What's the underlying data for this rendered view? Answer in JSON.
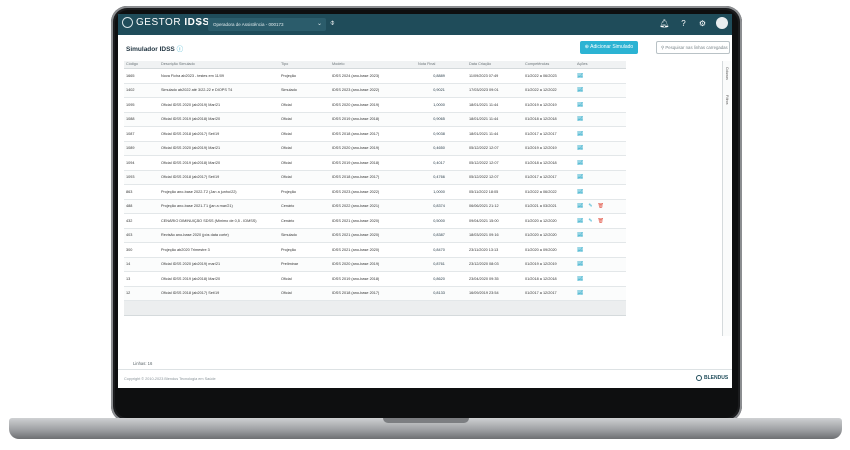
{
  "app": {
    "logo_light": "GESTOR ",
    "logo_bold": "IDSS",
    "org_select": "Operadora de Assistência - 000173"
  },
  "page": {
    "title": "Simulador IDSS",
    "add_button": "Adicionar Simulado",
    "search_placeholder": "Pesquisar nas linhas carregadas"
  },
  "table": {
    "columns": [
      "Código",
      "Descrição Simulado",
      "Tipo",
      "Modelo",
      "Nota Final",
      "Data Criação",
      "Competências",
      "Ações"
    ],
    "rows": [
      {
        "codigo": "1665",
        "descricao": "Nova Ficha ab2023 - testes em 11/09",
        "tipo": "Projeção",
        "modelo": "IDSS 2024 (ano-base 2023)",
        "nota": "0,8889",
        "data": "11/09/2023 07:49",
        "comp": "01/2022 a 06/2023",
        "acoes": [
          "chart"
        ]
      },
      {
        "codigo": "1402",
        "descricao": "Simulado ab2022 até 3/22-22 e DIOPS T4",
        "tipo": "Simulado",
        "modelo": "IDSS 2023 (ano-base 2022)",
        "nota": "0,9021",
        "data": "17/03/2023 09:01",
        "comp": "01/2022 a 12/2022",
        "acoes": [
          "chart"
        ]
      },
      {
        "codigo": "1095",
        "descricao": "Oficial IDSS 2020 (ab2019) Mar/21",
        "tipo": "Oficial",
        "modelo": "IDSS 2020 (ano-base 2019)",
        "nota": "1,0000",
        "data": "18/01/2021 11:44",
        "comp": "01/2019 a 12/2019",
        "acoes": [
          "chart"
        ]
      },
      {
        "codigo": "1088",
        "descricao": "Oficial IDSS 2019 (ab2018) Mar/20",
        "tipo": "Oficial",
        "modelo": "IDSS 2019 (ano-base 2018)",
        "nota": "0,9065",
        "data": "18/01/2021 11:44",
        "comp": "01/2018 a 12/2018",
        "acoes": [
          "chart"
        ]
      },
      {
        "codigo": "1087",
        "descricao": "Oficial IDSS 2018 (ab2017) Set/19",
        "tipo": "Oficial",
        "modelo": "IDSS 2018 (ano-base 2017)",
        "nota": "0,9038",
        "data": "18/01/2021 11:44",
        "comp": "01/2017 a 12/2017",
        "acoes": [
          "chart"
        ]
      },
      {
        "codigo": "1089",
        "descricao": "Oficial IDSS 2020 (ab2019) Mar/21",
        "tipo": "Oficial",
        "modelo": "IDSS 2020 (ano-base 2019)",
        "nota": "0,4650",
        "data": "05/12/2022 12:07",
        "comp": "01/2019 a 12/2019",
        "acoes": [
          "chart"
        ]
      },
      {
        "codigo": "1094",
        "descricao": "Oficial IDSS 2019 (ab2018) Mar/20",
        "tipo": "Oficial",
        "modelo": "IDSS 2019 (ano-base 2018)",
        "nota": "0,4017",
        "data": "05/12/2022 12:07",
        "comp": "01/2018 a 12/2018",
        "acoes": [
          "chart"
        ]
      },
      {
        "codigo": "1093",
        "descricao": "Oficial IDSS 2018 (ab2017) Set/19",
        "tipo": "Oficial",
        "modelo": "IDSS 2018 (ano-base 2017)",
        "nota": "0,4766",
        "data": "05/12/2022 12:07",
        "comp": "01/2017 a 12/2017",
        "acoes": [
          "chart"
        ]
      },
      {
        "codigo": "863",
        "descricao": "Projeção ano-base 2022-T2 (Jan a junho/22)",
        "tipo": "Projeção",
        "modelo": "IDSS 2023 (ano-base 2022)",
        "nota": "1,0000",
        "data": "05/11/2022 18:05",
        "comp": "01/2022 a 06/2022",
        "acoes": [
          "chart"
        ]
      },
      {
        "codigo": "488",
        "descricao": "Projeção ano-base 2021-T1 (jan a mar/21)",
        "tipo": "Cenário",
        "modelo": "IDSS 2022 (ano-base 2021)",
        "nota": "0,8374",
        "data": "06/06/2021 21:12",
        "comp": "01/2021 a 03/2021",
        "acoes": [
          "chart",
          "edit",
          "delete"
        ]
      },
      {
        "codigo": "432",
        "descricao": "CENÁRIO DIMINUIÇÃO SDSS (Mínimo de 0,5 - IDMSS)",
        "tipo": "Cenário",
        "modelo": "IDSS 2021 (ano-base 2020)",
        "nota": "0,5000",
        "data": "09/04/2021 15:00",
        "comp": "01/2020 a 12/2020",
        "acoes": [
          "chart",
          "edit",
          "delete"
        ]
      },
      {
        "codigo": "403",
        "descricao": "Revisão ano-base 2020 (pós data corte)",
        "tipo": "Simulado",
        "modelo": "IDSS 2021 (ano-base 2020)",
        "nota": "0,8387",
        "data": "18/03/2021 09:16",
        "comp": "01/2020 a 12/2020",
        "acoes": [
          "chart"
        ]
      },
      {
        "codigo": "300",
        "descricao": "Projeção ab2020 Trimestre 3",
        "tipo": "Projeção",
        "modelo": "IDSS 2021 (ano-base 2020)",
        "nota": "0,8470",
        "data": "23/11/2020 13:13",
        "comp": "01/2020 a 09/2020",
        "acoes": [
          "chart"
        ]
      },
      {
        "codigo": "14",
        "descricao": "Oficial IDSS 2020 (ab2019) mar/21",
        "tipo": "Preliminar",
        "modelo": "IDSS 2020 (ano-base 2019)",
        "nota": "0,8761",
        "data": "23/12/2020 08:03",
        "comp": "01/2019 a 12/2019",
        "acoes": [
          "chart"
        ]
      },
      {
        "codigo": "13",
        "descricao": "Oficial IDSS 2019 (ab2018) Mar/20",
        "tipo": "Oficial",
        "modelo": "IDSS 2019 (ano-base 2018)",
        "nota": "0,8620",
        "data": "23/04/2020 09:35",
        "comp": "01/2018 a 12/2018",
        "acoes": [
          "chart"
        ]
      },
      {
        "codigo": "12",
        "descricao": "Oficial IDSS 2018 (ab2017) Set/19",
        "tipo": "Oficial",
        "modelo": "IDSS 2018 (ano-base 2017)",
        "nota": "0,8133",
        "data": "16/09/2019 23:54",
        "comp": "01/2017 a 12/2017",
        "acoes": [
          "chart"
        ]
      }
    ]
  },
  "side_panel": {
    "columns_label": "Colunas",
    "filters_label": "Filtros"
  },
  "footer": {
    "rows_label": "Linhas: 16",
    "copyright": "Copyright © 2010-2023 Blendus Tecnologia em Saúde",
    "brand": "BLENDUS"
  },
  "colors": {
    "topbar": "#1f4c5a",
    "accent": "#2bb3d3",
    "delete": "#e04a3a",
    "bar_good": "#5ab04b",
    "bar_mid": "#e6c02c"
  }
}
